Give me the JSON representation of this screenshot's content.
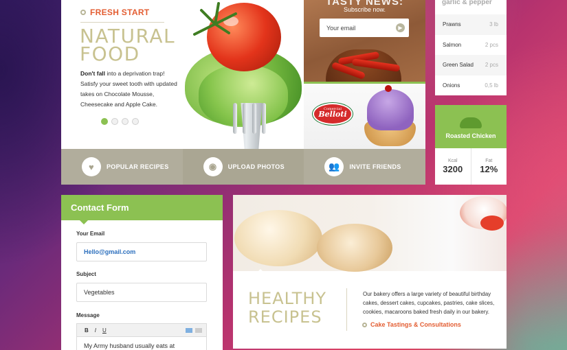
{
  "hero": {
    "tag": "FRESH START",
    "title_line1": "NATURAL",
    "title_line2": "FOOD",
    "desc_bold": "Don't fall",
    "desc_rest": " into a deprivation trap! Satisfy your sweet tooth with updated takes on Chocolate Mousse, Cheesecake and Apple Cake.",
    "slides": 4,
    "active_slide": 1
  },
  "news": {
    "title": "TASTY NEWS:",
    "subtitle": "Subscribe now.",
    "input_placeholder": "Your email"
  },
  "promo": {
    "badge_small": "Comercial",
    "badge": "Belloti"
  },
  "actions": [
    {
      "label": "POPULAR RECIPES",
      "icon": "heart-icon",
      "glyph": "♥"
    },
    {
      "label": "UPLOAD PHOTOS",
      "icon": "camera-icon",
      "glyph": "◉"
    },
    {
      "label": "INVITE FRIENDS",
      "icon": "users-icon",
      "glyph": "👥"
    }
  ],
  "ingredients": {
    "title": "garlic & pepper",
    "items": [
      {
        "name": "Prawns",
        "qty": "3 lb"
      },
      {
        "name": "Salmon",
        "qty": "2 pcs"
      },
      {
        "name": "Green Salad",
        "qty": "2 pcs"
      },
      {
        "name": "Onions",
        "qty": "0,5 lb"
      }
    ]
  },
  "recipe": {
    "title": "Roasted Chicken",
    "kcal_label": "Kcal",
    "kcal_value": "3200",
    "fat_label": "Fat",
    "fat_value": "12%"
  },
  "contact": {
    "title": "Contact Form",
    "email_label": "Your Email",
    "email_value": "Hello@gmail.com",
    "subject_label": "Subject",
    "subject_value": "Vegetables",
    "message_label": "Message",
    "toolbar_bold": "B",
    "toolbar_italic": "I",
    "toolbar_underline": "U",
    "message_value": "My Army husband usually eats at"
  },
  "healthy": {
    "title_line1": "HEALTHY",
    "title_line2": "RECIPES",
    "text": "Our bakery offers a large variety of beautiful birthday cakes, dessert cakes, cupcakes, pastries, cake slices, cookies, macaroons baked fresh daily in our bakery.",
    "link": "Cake Tastings & Consultations"
  },
  "colors": {
    "accent_green": "#8cc152",
    "accent_orange": "#e35d32",
    "title_beige": "#c8c290",
    "bar_gray": "#b1ad9c"
  }
}
